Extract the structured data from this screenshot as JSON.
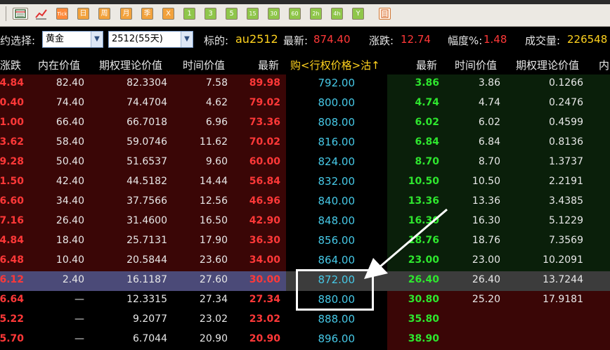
{
  "toolbar": {
    "buttons": [
      {
        "name": "list-view-icon",
        "text": ""
      },
      {
        "name": "chart-icon",
        "text": ""
      },
      {
        "name": "tick-button",
        "text": "Tick"
      },
      {
        "name": "day-button",
        "text": "日"
      },
      {
        "name": "week-button",
        "text": "周"
      },
      {
        "name": "month-button",
        "text": "月"
      },
      {
        "name": "season-button",
        "text": "季"
      },
      {
        "name": "close-x-button",
        "text": "X"
      },
      {
        "name": "min1-button",
        "text": "1"
      },
      {
        "name": "min3-button",
        "text": "3"
      },
      {
        "name": "min5-button",
        "text": "5"
      },
      {
        "name": "min15-button",
        "text": "15"
      },
      {
        "name": "min30-button",
        "text": "30"
      },
      {
        "name": "min60-button",
        "text": "60"
      },
      {
        "name": "hour2-button",
        "text": "2h"
      },
      {
        "name": "hour4-button",
        "text": "4h"
      },
      {
        "name": "year-button",
        "text": "Y"
      },
      {
        "name": "calculator-icon",
        "text": ""
      }
    ]
  },
  "info": {
    "contract_label": "约选择:",
    "underlying_select": "黄金",
    "expiry_select": "2512(55天)",
    "target_label": "标的:",
    "target_value": "au2512",
    "latest_label": "最新:",
    "latest_value": "874.40",
    "change_label": "涨跌:",
    "change_value": "12.74",
    "pct_label": "幅度%:",
    "pct_value": "1.48",
    "volume_label": "成交量:",
    "volume_value": "226548"
  },
  "headers": {
    "call_change": "涨跌",
    "call_intrinsic": "内在价值",
    "call_theoretical": "期权理论价值",
    "call_time": "时间价值",
    "call_last": "最新",
    "strike": "购<行权价格>沽↑",
    "put_last": "最新",
    "put_time": "时间价值",
    "put_theoretical": "期权理论价值",
    "put_intrinsic": "内"
  },
  "rows": [
    {
      "c_chg": "4.84",
      "c_int": "82.40",
      "c_theo": "82.3304",
      "c_time": "7.58",
      "c_last": "89.98",
      "strike": "792.00",
      "p_last": "3.86",
      "p_time": "3.86",
      "p_theo": "0.1266"
    },
    {
      "c_chg": "0.40",
      "c_int": "74.40",
      "c_theo": "74.4704",
      "c_time": "4.62",
      "c_last": "79.02",
      "strike": "800.00",
      "p_last": "4.74",
      "p_time": "4.74",
      "p_theo": "0.2476"
    },
    {
      "c_chg": "1.00",
      "c_int": "66.40",
      "c_theo": "66.7018",
      "c_time": "6.96",
      "c_last": "73.36",
      "strike": "808.00",
      "p_last": "6.02",
      "p_time": "6.02",
      "p_theo": "0.4599"
    },
    {
      "c_chg": "3.62",
      "c_int": "58.40",
      "c_theo": "59.0746",
      "c_time": "11.62",
      "c_last": "70.02",
      "strike": "816.00",
      "p_last": "6.84",
      "p_time": "6.84",
      "p_theo": "0.8136"
    },
    {
      "c_chg": "9.28",
      "c_int": "50.40",
      "c_theo": "51.6537",
      "c_time": "9.60",
      "c_last": "60.00",
      "strike": "824.00",
      "p_last": "8.70",
      "p_time": "8.70",
      "p_theo": "1.3737"
    },
    {
      "c_chg": "1.50",
      "c_int": "42.40",
      "c_theo": "44.5182",
      "c_time": "14.44",
      "c_last": "56.84",
      "strike": "832.00",
      "p_last": "10.50",
      "p_time": "10.50",
      "p_theo": "2.2191"
    },
    {
      "c_chg": "6.60",
      "c_int": "34.40",
      "c_theo": "37.7566",
      "c_time": "12.56",
      "c_last": "46.96",
      "strike": "840.00",
      "p_last": "13.36",
      "p_time": "13.36",
      "p_theo": "3.4385"
    },
    {
      "c_chg": "7.16",
      "c_int": "26.40",
      "c_theo": "31.4600",
      "c_time": "16.50",
      "c_last": "42.90",
      "strike": "848.00",
      "p_last": "16.30",
      "p_time": "16.30",
      "p_theo": "5.1229"
    },
    {
      "c_chg": "4.84",
      "c_int": "18.40",
      "c_theo": "25.7131",
      "c_time": "17.90",
      "c_last": "36.30",
      "strike": "856.00",
      "p_last": "18.76",
      "p_time": "18.76",
      "p_theo": "7.3569"
    },
    {
      "c_chg": "6.48",
      "c_int": "10.40",
      "c_theo": "20.5844",
      "c_time": "23.60",
      "c_last": "34.00",
      "strike": "864.00",
      "p_last": "23.00",
      "p_time": "23.00",
      "p_theo": "10.2091"
    },
    {
      "c_chg": "6.12",
      "c_int": "2.40",
      "c_theo": "16.1187",
      "c_time": "27.60",
      "c_last": "30.00",
      "strike": "872.00",
      "p_last": "26.40",
      "p_time": "26.40",
      "p_theo": "13.7244"
    },
    {
      "c_chg": "6.64",
      "c_int": "—",
      "c_theo": "12.3315",
      "c_time": "27.34",
      "c_last": "27.34",
      "strike": "880.00",
      "p_last": "30.80",
      "p_time": "25.20",
      "p_theo": "17.9181"
    },
    {
      "c_chg": "5.22",
      "c_int": "—",
      "c_theo": "9.2077",
      "c_time": "23.02",
      "c_last": "23.02",
      "strike": "888.00",
      "p_last": "35.80",
      "p_time": "",
      "p_theo": ""
    },
    {
      "c_chg": "5.70",
      "c_int": "—",
      "c_theo": "6.7044",
      "c_time": "20.90",
      "c_last": "20.90",
      "strike": "896.00",
      "p_last": "38.90",
      "p_time": "",
      "p_theo": ""
    }
  ],
  "colors": {
    "call_itm_bg": "#3a0606",
    "put_itm_bg": "#0a1f0a",
    "highlight_row_bg": "#4b4a78",
    "strike_text": "#46c8e6",
    "call_text": "#ff3838",
    "put_text": "#2ee62e",
    "white_text": "#e8e8e8"
  }
}
